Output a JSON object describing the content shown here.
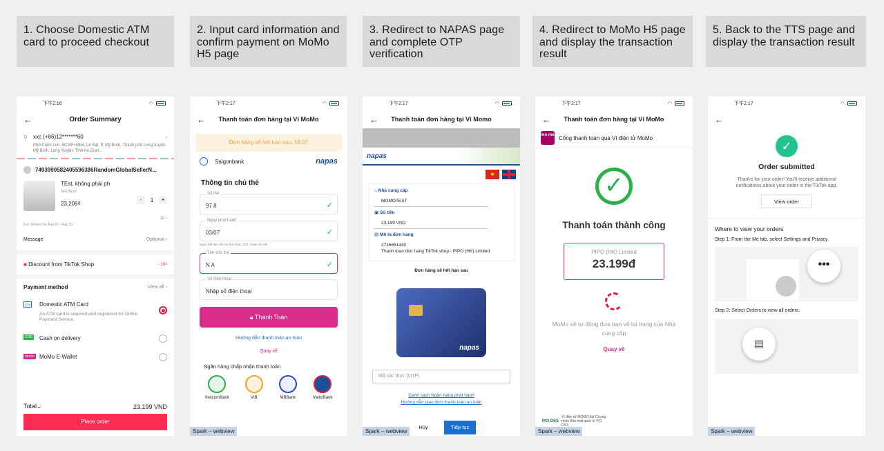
{
  "steps": [
    "1. Choose Domestic ATM card to proceed checkout",
    "2. Input card information and confirm payment on MoMo H5 page",
    "3. Redirect to NAPAS page and complete OTP verification",
    "4. Redirect to MoMo H5 page and display the transaction result",
    "5. Back to the TTS page and display the transaction result"
  ],
  "status_time": "下午2:16",
  "status_time2": "下午2:17",
  "spark": "Spark – webview",
  "p1": {
    "title": "Order Summary",
    "name": "xxc (+86)12*******60",
    "address": "Phố Cánh Lún, 9CMP+M64, Lê Sát, P. Mỹ Bình, Thành phố Long Xuyên Mỹ Bình, Long Xuyên, Tỉnh An Gian...",
    "shop": "7493990582405596386RandomGlobalSellerN...",
    "product": "TEst, không phải ph",
    "variant": "fasdfasd",
    "price": "23.206₫",
    "minus": "-",
    "qty": "1",
    "plus": "+",
    "ship_days": "3d",
    "delivery": "Est. delivery by Aug 16 - Aug 20",
    "message": "Message",
    "optional": "Optional",
    "discount": "Discount from TikTok Shop",
    "discount_val": "- 10₫",
    "pm": "Payment method",
    "view_all": "View all",
    "atm": "Domestic ATM Card",
    "atm_desc": "An ATM card is required and registered for Online Payment Service.",
    "atm_badge": "ATM",
    "cod": "Cash on delivery",
    "cod_badge": "COD",
    "momo": "MoMo E-Wallet",
    "momo_badge": "momo",
    "total": "Total",
    "total_val": "23.199 VND",
    "place": "Place order"
  },
  "p2": {
    "title": "Thanh toán đơn hàng tại Ví MoMo",
    "expire": "Đơn hàng sẽ hết hạn sau: 59:07",
    "bank": "Saigonbank",
    "napas": "napas",
    "section": "Thông tin chủ thẻ",
    "card_lbl": "Số thẻ",
    "card_val": "97                    8",
    "date_lbl": "Ngày phát hành",
    "date_val": "03/07",
    "note": "Ngày hết hạn đối với thẻ TCB, ACB, Seab và VIB",
    "name_lbl": "Tên chủ thẻ",
    "name_val": "N                      A",
    "phone_lbl": "Số điện thoại",
    "phone_ph": "Nhập số điện thoại",
    "pay": "Thanh Toán",
    "guide": "Hướng dẫn thanh toán an toàn",
    "back": "Quay về",
    "accept": "Ngân hàng chấp nhận thanh toán",
    "banks": [
      "VietcomBank",
      "VIB",
      "MBBank",
      "VietinBank"
    ]
  },
  "p3": {
    "title": "Thanh toán đơn hàng tại Ví Momo",
    "napas": "napas",
    "provider_lbl": "Nhà cung cấp",
    "provider": "MOMOTEST",
    "amount_lbl": "Số tiền",
    "amount": "23.199 VND",
    "desc_lbl": "Mô tả đơn hàng",
    "desc_id": "2715651440",
    "desc": "Thanh toan don hang TikTok shop - PIPO (HK) Limited",
    "expire": "Đơn hàng sẽ hết hạn sau",
    "otp_ph": "Mã xác thực (OTP)",
    "link1": "Danh sách Ngân hàng phát hành",
    "link2": "Hướng dẫn giao dịch thanh toán an toàn",
    "cancel": "Hủy",
    "cont": "Tiếp tục"
  },
  "p4": {
    "title": "Thanh toán đơn hàng tại Ví MoMo",
    "gateway": "Cổng thanh toán qua Ví điện tử MoMo",
    "logo": "mo mo",
    "success": "Thanh toán thành công",
    "merchant": "PIPO (HK) Limited",
    "amount": "23.199đ",
    "redirect": "MoMo sẽ tự động đưa bạn về lại trang của Nhà cung cấp",
    "back": "Quay về",
    "pci": "PCI DSS",
    "pci_text": "Ví điện tử MOMO đạt Chứng nhận Bảo mật quốc tế PCI DSS"
  },
  "p5": {
    "title": "Order submitted",
    "desc": "Thanks for your order! You'll receive additional notifications about your order in the TikTok app.",
    "view": "View order",
    "where": "Where to view your orders",
    "step1": "Step 1: From the Me tab, select Settings and Privacy.",
    "step2": "Step 2: Select Orders to view all orders."
  },
  "colors": {
    "tiktok_red": "#fe2c55",
    "momo_pink": "#d82d8b",
    "napas_blue": "#1b4e9b",
    "success_green": "#2ab14a"
  }
}
